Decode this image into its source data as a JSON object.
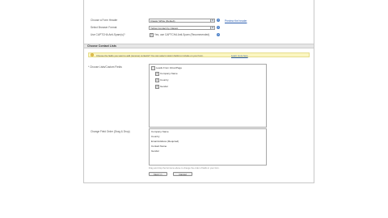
{
  "form": {
    "theme_label": "Choose a Form Header",
    "theme_value": "Classic White (Default)",
    "preview_link": "Preview the header",
    "browser_label": "Select Browser Format",
    "browser_value": "Yellow Contact by Classic",
    "captcha_label": "Use CAPTCHA Anti-Spam(s)?",
    "captcha_text": "Yes, use CAPTCHA Anti-Spam (Recommended)"
  },
  "section": {
    "title": "Choose Contact Lists"
  },
  "notice": {
    "text": "Choose the fields you want to add (remove) contacts? You can select custom fields to include on your form.",
    "link": "Learn more here"
  },
  "fields_select": {
    "label": "* Choose Lists/Custom Fields",
    "parent_label": "Leads From Inbox/Page",
    "children": [
      "Company Name",
      "Country",
      "Gender"
    ]
  },
  "order": {
    "label": "Change Field Order (Drag & Drop)",
    "items": [
      "Company Name",
      "Country",
      "Email Address (Required)",
      "Contact Name",
      "Gender"
    ]
  },
  "hint": "Drag and drop the list items above to change the order of fields in your form.",
  "buttons": {
    "next": "Next >>",
    "cancel": "Cancel"
  }
}
